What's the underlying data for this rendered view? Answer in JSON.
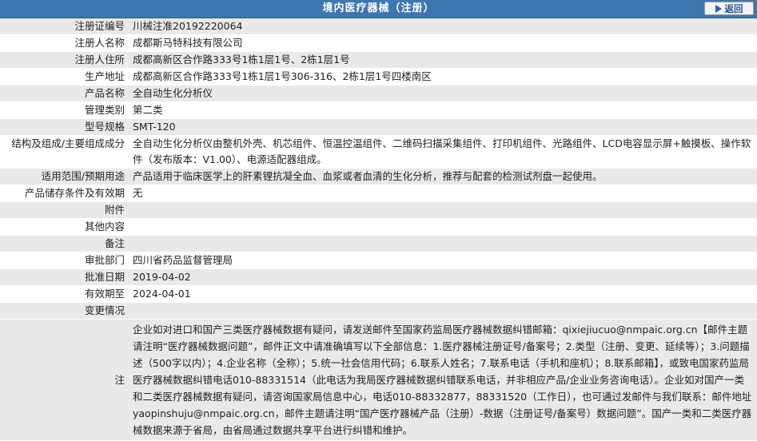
{
  "header": {
    "title": "境内医疗器械（注册）",
    "back_label": "返回"
  },
  "rows": [
    {
      "label": "注册证编号",
      "value": "川械注准20192220064"
    },
    {
      "label": "注册人名称",
      "value": "成都斯马特科技有限公司"
    },
    {
      "label": "注册人住所",
      "value": "成都高新区合作路333号1栋1层1号、2栋1层1号"
    },
    {
      "label": "生产地址",
      "value": "成都高新区合作路333号1栋1层1号306-316、2栋1层1号四楼南区"
    },
    {
      "label": "产品名称",
      "value": "全自动生化分析仪"
    },
    {
      "label": "管理类别",
      "value": "第二类"
    },
    {
      "label": "型号规格",
      "value": "SMT-120"
    },
    {
      "label": "结构及组成/主要组成成分",
      "value": "全自动生化分析仪由整机外壳、机芯组件、恒温控温组件、二维码扫描采集组件、打印机组件、光路组件、LCD电容显示屏+触摸板、操作软件（发布版本：V1.00）、电源适配器组成。"
    },
    {
      "label": "适用范围/预期用途",
      "value": "产品适用于临床医学上的肝素锂抗凝全血、血浆或者血清的生化分析，推荐与配套的检测试剂盘一起使用。"
    },
    {
      "label": "产品储存条件及有效期",
      "value": "无"
    },
    {
      "label": "附件",
      "value": ""
    },
    {
      "label": "其他内容",
      "value": ""
    },
    {
      "label": "备注",
      "value": ""
    },
    {
      "label": "审批部门",
      "value": "四川省药品监督管理局"
    },
    {
      "label": "批准日期",
      "value": "2019-04-02"
    },
    {
      "label": "有效期至",
      "value": "2024-04-01"
    },
    {
      "label": "变更情况",
      "value": ""
    }
  ],
  "note": {
    "label": "注",
    "text": "企业如对进口和国产三类医疗器械数据有疑问，请发送邮件至国家药监局医疗器械数据纠错邮箱：qixiejiucuo@nmpaic.org.cn【邮件主题请注明“医疗器械数据问题”，邮件正文中请准确填写以下全部信息：1.医疗器械注册证号/备案号；2.类型（注册、变更、延续等）；3.问题描述（500字以内）；4.企业名称（全称）；5.统一社会信用代码；6.联系人姓名；7.联系电话（手机和座机）；8.联系邮箱】，或致电国家药监局医疗器械数据纠错电话010-88331514（此电话为我局医疗器械数据纠错联系电话，并非相应产品/企业业务咨询电话）。企业如对国产一类和二类医疗器械数据有疑问，请咨询国家局信息中心，电话010-88332877，88331520（工作日），也可通过发邮件与我们联系：邮件地址yaopinshuju@nmpaic.org.cn，邮件主题请注明“国产医疗器械产品（注册）-数据（注册证号/备案号）数据问题”。国产一类和二类医疗器械数据来源于省局，由省局通过数据共享平台进行纠错和维护。"
  }
}
